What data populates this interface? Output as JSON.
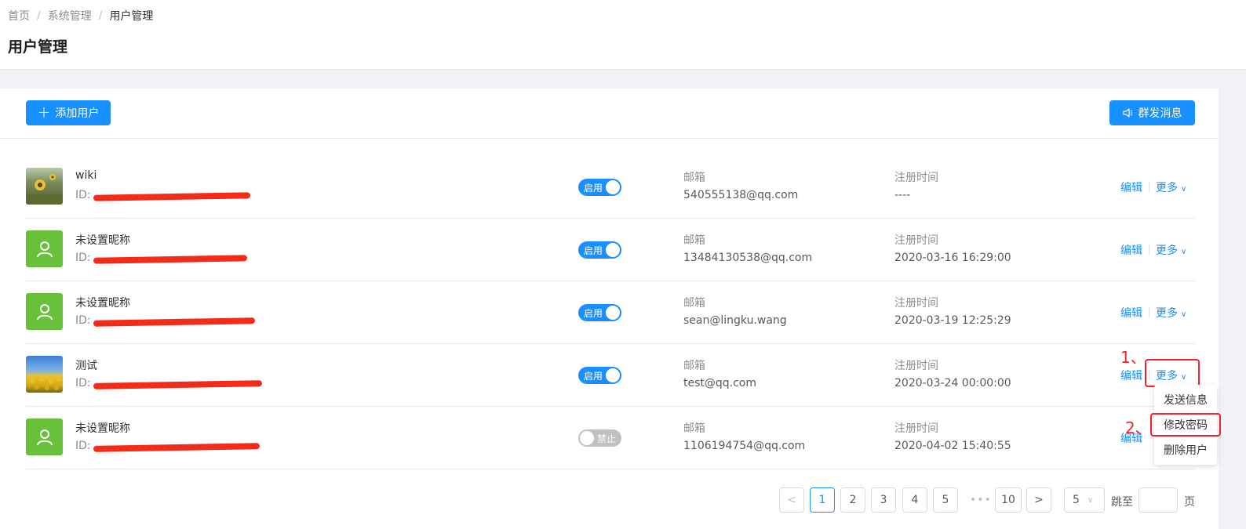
{
  "breadcrumb": [
    "首页",
    "系统管理",
    "用户管理"
  ],
  "page_title": "用户管理",
  "toolbar": {
    "add_label": "添加用户",
    "broadcast_label": "群发消息"
  },
  "columns": {
    "email_label": "邮箱",
    "time_label": "注册时间"
  },
  "users": [
    {
      "name": "wiki",
      "id_prefix": "ID:",
      "status": "启用",
      "enabled": true,
      "email": "540555138@qq.com",
      "registered": "----",
      "avatar": "sunflower-photo"
    },
    {
      "name": "未设置昵称",
      "id_prefix": "ID:",
      "status": "启用",
      "enabled": true,
      "email": "13484130538@qq.com",
      "registered": "2020-03-16 16:29:00",
      "avatar": "default-user"
    },
    {
      "name": "未设置昵称",
      "id_prefix": "ID:",
      "status": "启用",
      "enabled": true,
      "email": "sean@lingku.wang",
      "registered": "2020-03-19 12:25:29",
      "avatar": "default-user"
    },
    {
      "name": "测试",
      "id_prefix": "ID:",
      "status": "启用",
      "enabled": true,
      "email": "test@qq.com",
      "registered": "2020-03-24 00:00:00",
      "avatar": "sunflower-field-photo"
    },
    {
      "name": "未设置昵称",
      "id_prefix": "ID:",
      "status": "禁止",
      "enabled": false,
      "email": "1106194754@qq.com",
      "registered": "2020-04-02 15:40:55",
      "avatar": "default-user"
    }
  ],
  "actions": {
    "edit": "编辑",
    "more": "更多"
  },
  "dropdown": [
    "发送信息",
    "修改密码",
    "删除用户"
  ],
  "annotations": {
    "step1": "1、",
    "step2": "2、"
  },
  "pagination": {
    "pages": [
      "1",
      "2",
      "3",
      "4",
      "5",
      "10"
    ],
    "current": "1",
    "page_size": "5",
    "jump_label": "跳至",
    "page_suffix": "页",
    "ellipsis": "•••"
  },
  "colors": {
    "primary": "#1890ff",
    "annotation": "#f5222d",
    "avatar_default": "#67c23a"
  }
}
